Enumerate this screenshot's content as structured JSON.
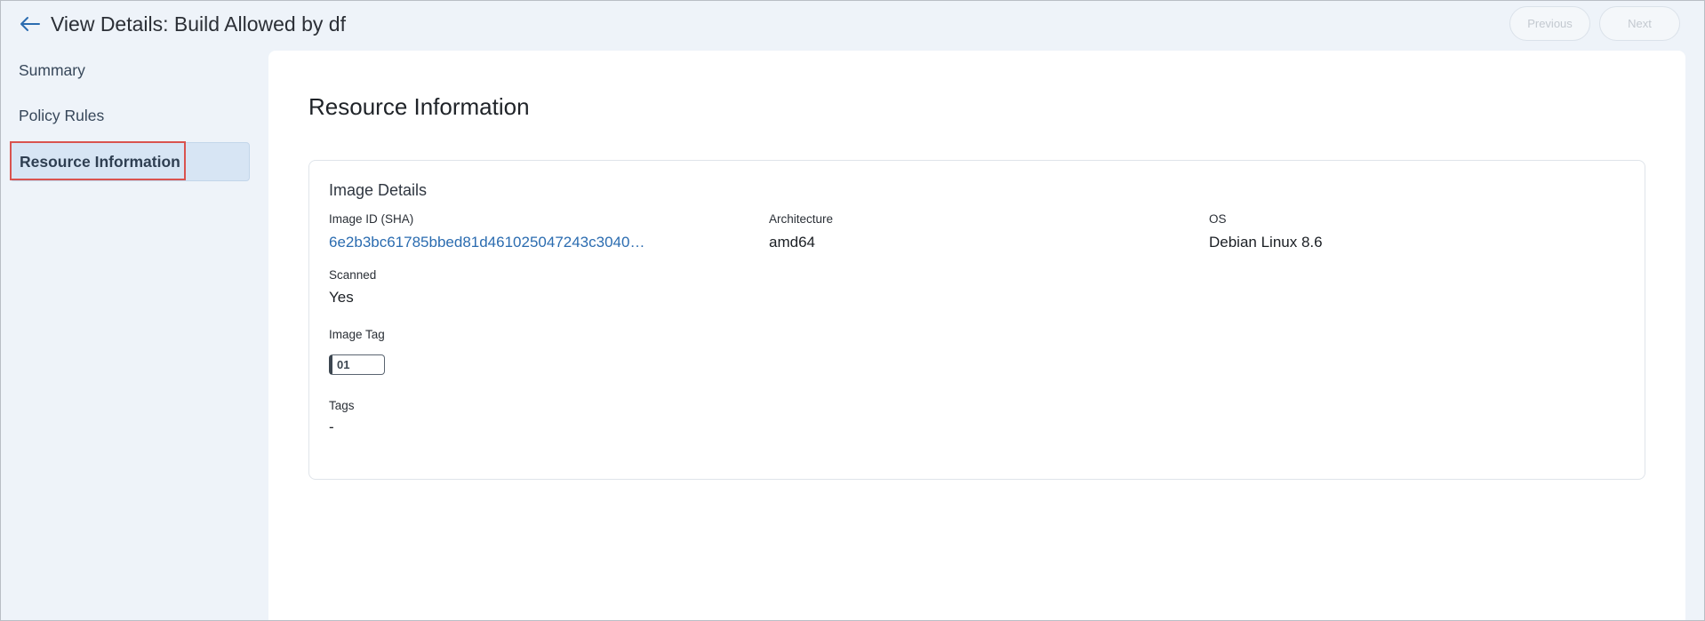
{
  "header": {
    "title": "View Details: Build Allowed by df",
    "previous_label": "Previous",
    "next_label": "Next"
  },
  "sidebar": {
    "items": [
      {
        "label": "Summary",
        "selected": false
      },
      {
        "label": "Policy Rules",
        "selected": false
      },
      {
        "label": "Resource Information",
        "selected": true
      }
    ]
  },
  "main": {
    "section_title": "Resource Information",
    "card": {
      "title": "Image Details",
      "fields": {
        "image_id": {
          "label": "Image ID (SHA)",
          "value": "6e2b3bc61785bbed81d461025047243c30403…"
        },
        "architecture": {
          "label": "Architecture",
          "value": "amd64"
        },
        "os": {
          "label": "OS",
          "value": "Debian Linux 8.6"
        },
        "scanned": {
          "label": "Scanned",
          "value": "Yes"
        },
        "image_tag": {
          "label": "Image Tag",
          "value": "01"
        },
        "tags": {
          "label": "Tags",
          "value": "-"
        }
      }
    }
  },
  "colors": {
    "accent_link": "#2b6cb0",
    "selected_bg": "#d7e5f4",
    "highlight_border": "#d9534f",
    "page_bg": "#eef3f9"
  },
  "icons": {
    "back": "arrow-left-icon"
  }
}
